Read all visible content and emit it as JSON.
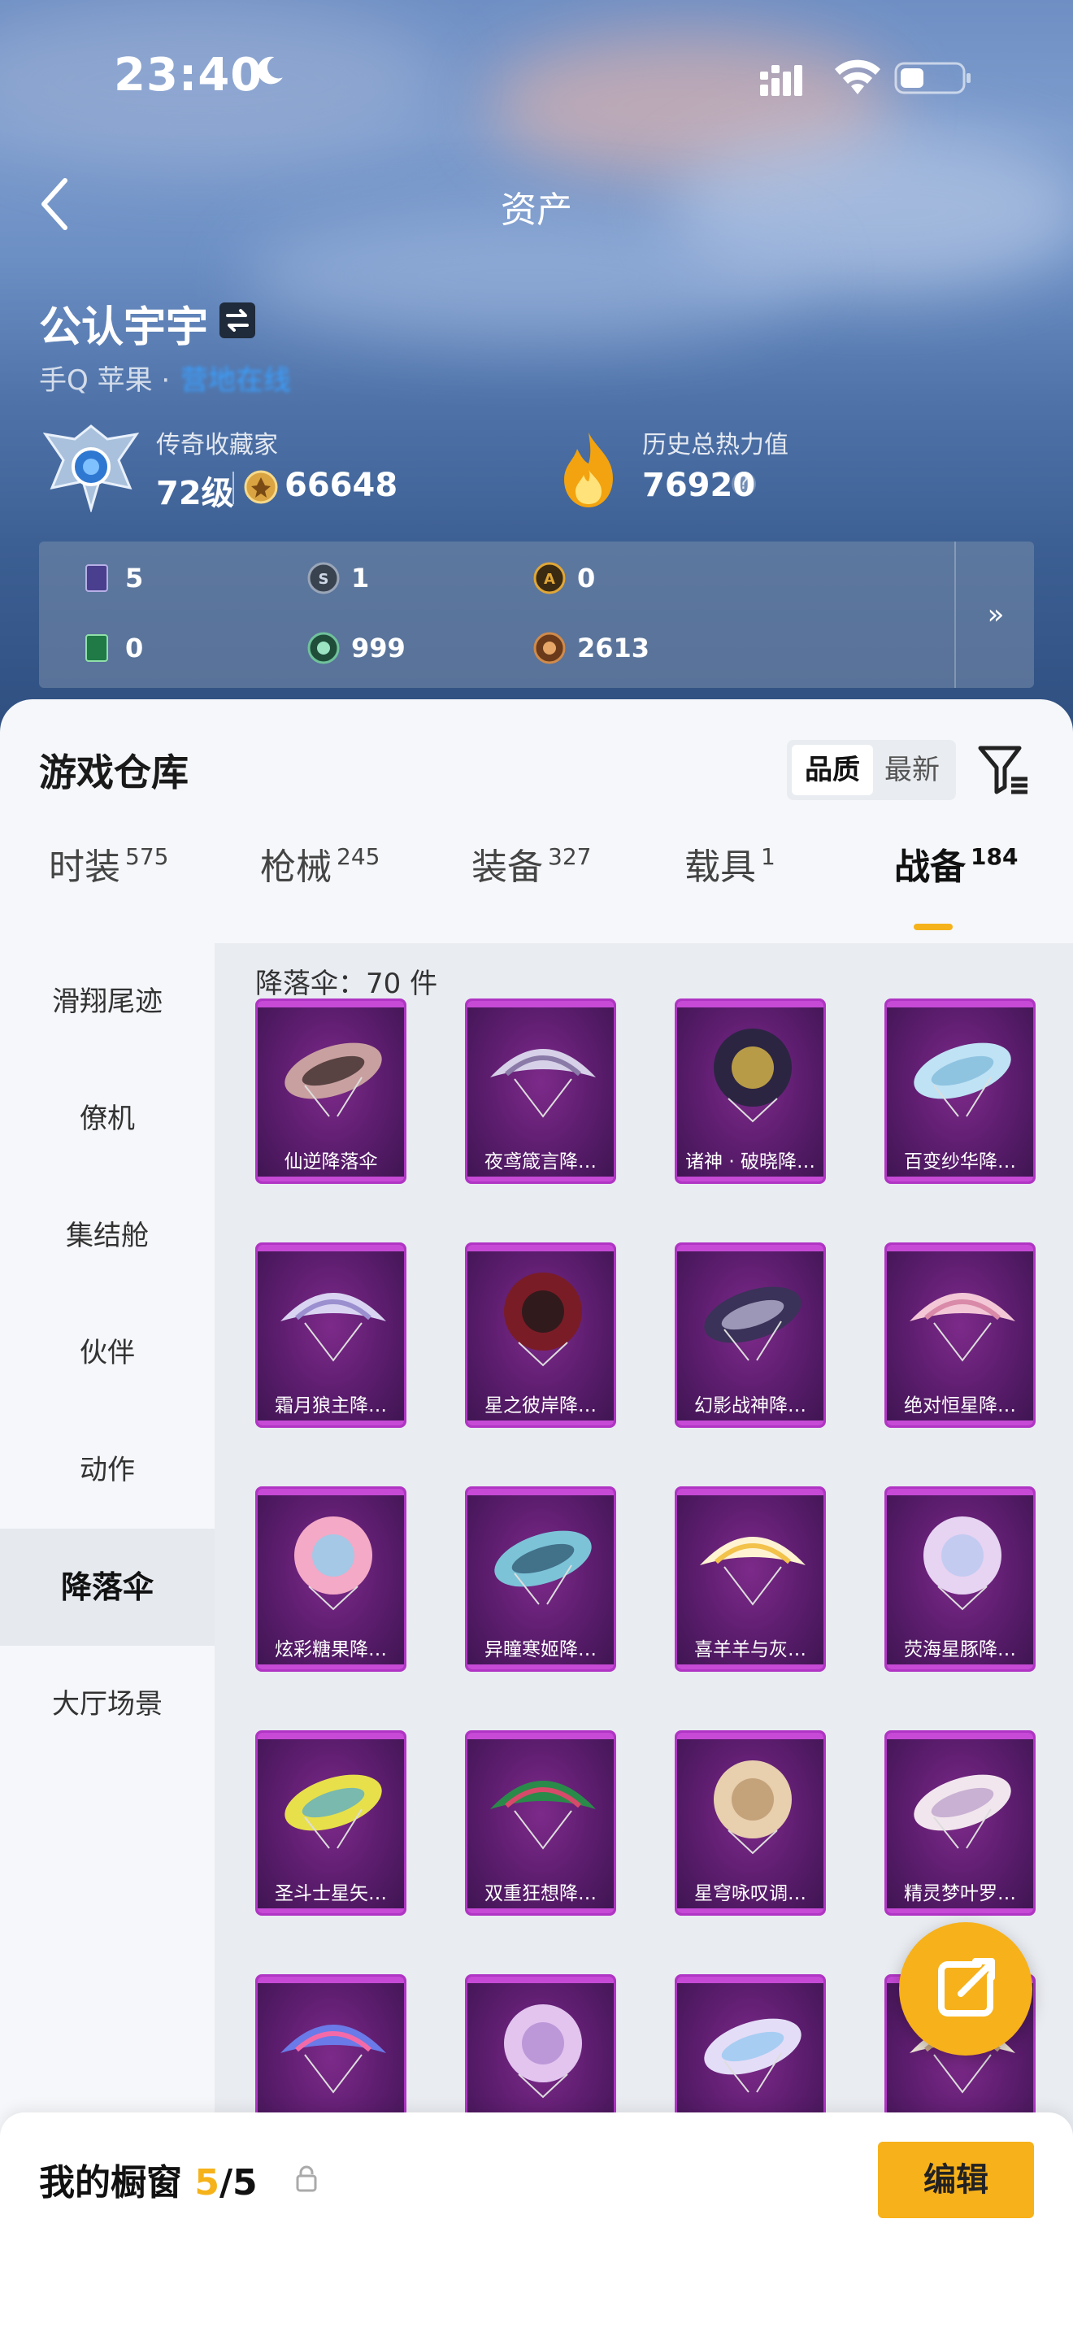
{
  "status": {
    "time": "23:40"
  },
  "nav": {
    "title": "资产"
  },
  "profile": {
    "name": "公认宇宇",
    "platform": "手Q 苹果 ·",
    "platform_link": "营地在线",
    "rank_title": "传奇收藏家",
    "level": "72级",
    "coins": "66648",
    "heat_title": "历史总热力值",
    "heat_value": "76920",
    "help": "?"
  },
  "currencies": [
    {
      "icon": "card-icon",
      "value": "5"
    },
    {
      "icon": "s-coin-icon",
      "value": "1"
    },
    {
      "icon": "a-coin-icon",
      "value": "0"
    },
    {
      "icon": "green-card-icon",
      "value": "0"
    },
    {
      "icon": "gem-icon",
      "value": "999"
    },
    {
      "icon": "bronze-coin-icon",
      "value": "2613"
    }
  ],
  "more": "»",
  "warehouse": {
    "title": "游戏仓库",
    "sort": [
      "品质",
      "最新"
    ],
    "tabs": [
      {
        "label": "时装",
        "count": "575"
      },
      {
        "label": "枪械",
        "count": "245"
      },
      {
        "label": "装备",
        "count": "327"
      },
      {
        "label": "载具",
        "count": "1"
      },
      {
        "label": "战备",
        "count": "184"
      }
    ],
    "side": [
      "滑翔尾迹",
      "僚机",
      "集结舱",
      "伙伴",
      "动作",
      "降落伞",
      "大厅场景"
    ],
    "count_label": "降落伞：70 件",
    "items": [
      "仙逆降落伞",
      "夜鸢箴言降…",
      "诸神 · 破晓降…",
      "百变纱华降…",
      "霜月狼主降…",
      "星之彼岸降…",
      "幻影战神降…",
      "绝对恒星降…",
      "炫彩糖果降…",
      "异瞳寒姬降…",
      "喜羊羊与灰…",
      "荧海星豚降…",
      "圣斗士星矢…",
      "双重狂想降…",
      "星穹咏叹调…",
      "精灵梦叶罗…",
      "",
      "",
      "",
      ""
    ]
  },
  "showcase": {
    "title_prefix": "我的橱窗 ",
    "current": "5",
    "total": "/5",
    "edit": "编辑"
  },
  "colors": {
    "accent": "#f7b11a",
    "card_purple": "#5a1c6c"
  }
}
